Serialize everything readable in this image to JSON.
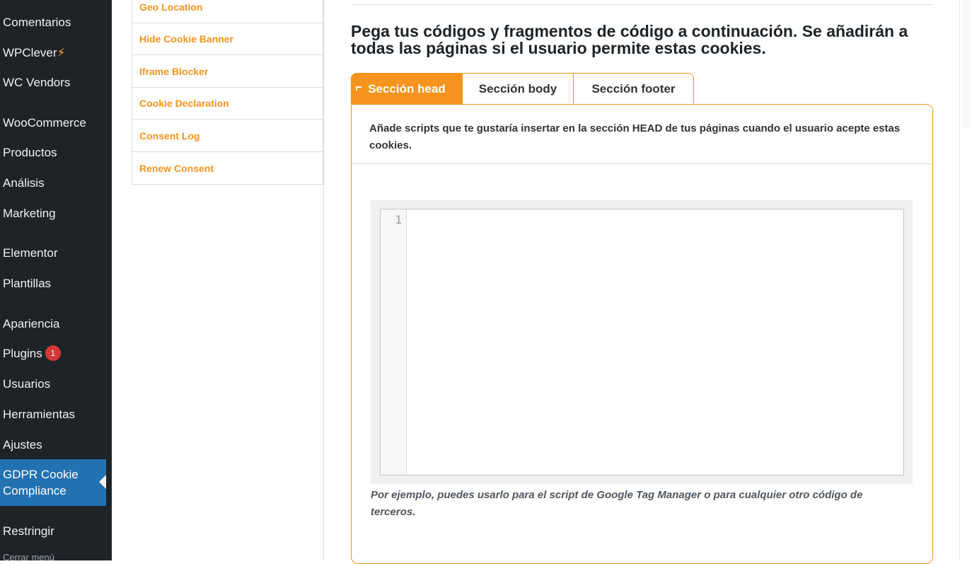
{
  "sidebar": {
    "items": [
      {
        "label": "Comentarios"
      },
      {
        "label": "WPClever",
        "suffix": "⚡"
      },
      {
        "label": "WC Vendors"
      },
      {
        "label": "WooCommerce"
      },
      {
        "label": "Productos"
      },
      {
        "label": "Análisis"
      },
      {
        "label": "Marketing"
      },
      {
        "label": "Elementor"
      },
      {
        "label": "Plantillas"
      },
      {
        "label": "Apariencia"
      },
      {
        "label": "Plugins",
        "badge": "1"
      },
      {
        "label": "Usuarios"
      },
      {
        "label": "Herramientas"
      },
      {
        "label": "Ajustes"
      },
      {
        "label": "GDPR Cookie Compliance"
      },
      {
        "label": "Restringir"
      }
    ],
    "collapse_label": "Cerrar menú"
  },
  "sub_nav": {
    "items": [
      {
        "label": "Geo Location"
      },
      {
        "label": "Hide Cookie Banner"
      },
      {
        "label": "Iframe Blocker"
      },
      {
        "label": "Cookie Declaration"
      },
      {
        "label": "Consent Log"
      },
      {
        "label": "Renew Consent"
      }
    ]
  },
  "main": {
    "heading": "Pega tus códigos y fragmentos de código a continuación. Se añadirán a todas las páginas si el usuario permite estas cookies.",
    "tabs": [
      {
        "label": "Sección head",
        "active": true
      },
      {
        "label": "Sección body",
        "active": false
      },
      {
        "label": "Sección footer",
        "active": false
      }
    ],
    "description": "Añade scripts que te gustaría insertar en la sección HEAD de tus páginas cuando el usuario acepte estas cookies.",
    "editor": {
      "line_number": "1",
      "content": ""
    },
    "hint": "Por ejemplo, puedes usarlo para el script de Google Tag Manager o para cualquier otro código de terceros."
  },
  "colors": {
    "accent": "#f7941d",
    "wp_sidebar": "#1d2327",
    "wp_active": "#2271b1",
    "badge": "#d63638"
  }
}
